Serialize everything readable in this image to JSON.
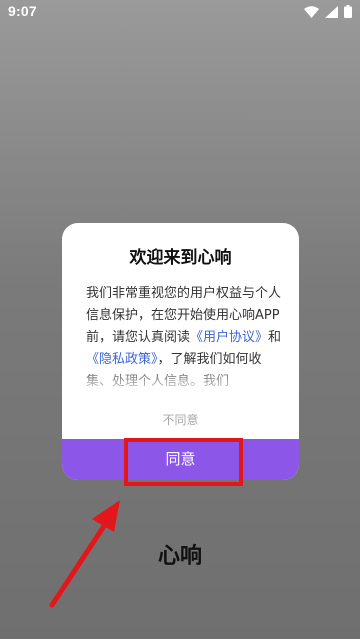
{
  "status_bar": {
    "time": "9:07"
  },
  "background": {
    "app_title": "心响"
  },
  "dialog": {
    "title": "欢迎来到心响",
    "body_part1": "我们非常重视您的用户权益与个人信息保护，在您开始使用心响APP前，请您认真阅读",
    "user_agreement_link": "《用户协议》",
    "and_text": "和",
    "privacy_policy_link": "《隐私政策》",
    "body_part2": "，了解我们如何收集、处理个人信息。我们",
    "disagree_label": "不同意",
    "agree_label": "同意"
  },
  "colors": {
    "accent": "#8c56e8",
    "link": "#3a66d6",
    "annotation": "#e3161b"
  },
  "icons": [
    "wifi-icon",
    "signal-icon",
    "battery-icon"
  ]
}
